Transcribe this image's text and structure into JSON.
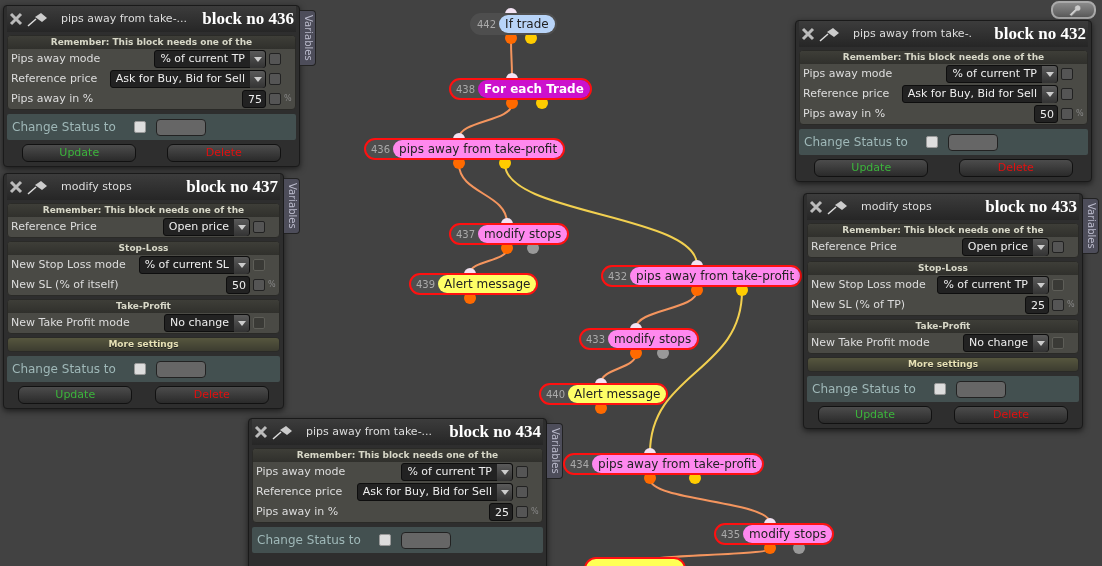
{
  "nodes": [
    {
      "number": "442",
      "label": "If trade",
      "color": "#b8d4f8",
      "outlined": false,
      "bold": false
    },
    {
      "number": "438",
      "label": "For each Trade",
      "color": "#cc11cc",
      "outlined": true,
      "bold": true
    },
    {
      "number": "436",
      "label": "pips away from take-profit",
      "color": "#ff88ee",
      "outlined": true,
      "bold": false
    },
    {
      "number": "437",
      "label": "modify stops",
      "color": "#ff88ee",
      "outlined": true,
      "bold": false
    },
    {
      "number": "439",
      "label": "Alert message",
      "color": "#ffff66",
      "outlined": true,
      "bold": false
    },
    {
      "number": "432",
      "label": "pips away from take-profit",
      "color": "#ff88ee",
      "outlined": true,
      "bold": false
    },
    {
      "number": "433",
      "label": "modify stops",
      "color": "#ff88ee",
      "outlined": true,
      "bold": false
    },
    {
      "number": "440",
      "label": "Alert message",
      "color": "#ffff66",
      "outlined": true,
      "bold": false
    },
    {
      "number": "434",
      "label": "pips away from take-profit",
      "color": "#ff88ee",
      "outlined": true,
      "bold": false
    },
    {
      "number": "435",
      "label": "modify stops",
      "color": "#ff88ee",
      "outlined": true,
      "bold": false
    }
  ],
  "panels": [
    {
      "title": "pips away from take-...",
      "block": "block no 436",
      "variables_tab": "Variables",
      "sections": [
        {
          "kind": "note",
          "header": "Remember: This block needs one of the",
          "rows": [
            {
              "kind": "select",
              "label": "Pips away mode",
              "value": "% of current TP",
              "checked": false,
              "disabled": false
            },
            {
              "kind": "select",
              "label": "Reference price",
              "value": "Ask for Buy, Bid for Sell",
              "checked": false,
              "disabled": false
            },
            {
              "kind": "number",
              "label": "Pips away in %",
              "value": "75",
              "unit": "%",
              "checked": false,
              "disabled": false
            }
          ]
        }
      ],
      "status": {
        "label": "Change Status to",
        "checked": false
      },
      "buttons": [
        {
          "label": "Update",
          "kind": "update"
        },
        {
          "label": "Delete",
          "kind": "delete"
        }
      ]
    },
    {
      "title": "pips away from take-.",
      "block": "block no 432",
      "sections": [
        {
          "kind": "note",
          "header": "Remember: This block needs one of the",
          "rows": [
            {
              "kind": "select",
              "label": "Pips away mode",
              "value": "% of current TP",
              "checked": false,
              "disabled": false
            },
            {
              "kind": "select",
              "label": "Reference price",
              "value": "Ask for Buy, Bid for Sell",
              "checked": false,
              "disabled": false
            },
            {
              "kind": "number",
              "label": "Pips away in %",
              "value": "50",
              "unit": "%",
              "checked": false,
              "disabled": false
            }
          ]
        }
      ],
      "status": {
        "label": "Change Status to",
        "checked": false
      },
      "buttons": [
        {
          "label": "Update",
          "kind": "update"
        },
        {
          "label": "Delete",
          "kind": "delete"
        }
      ]
    },
    {
      "title": "modify stops",
      "block": "block no 437",
      "variables_tab": "Variables",
      "sections": [
        {
          "kind": "note",
          "header": "Remember: This block needs one of the",
          "rows": [
            {
              "kind": "select",
              "label": "Reference Price",
              "value": "Open price",
              "checked": false,
              "disabled": false
            }
          ]
        },
        {
          "kind": "group",
          "header": "Stop-Loss",
          "rows": [
            {
              "kind": "select",
              "label": "New Stop Loss mode",
              "value": "% of current SL",
              "checked": false,
              "disabled": true
            },
            {
              "kind": "number",
              "label": "New SL (% of itself)",
              "value": "50",
              "unit": "%",
              "checked": false,
              "disabled": false
            }
          ]
        },
        {
          "kind": "group",
          "header": "Take-Profit",
          "rows": [
            {
              "kind": "select",
              "label": "New Take Profit mode",
              "value": "No change",
              "checked": false,
              "disabled": true
            }
          ]
        },
        {
          "kind": "more",
          "header": "More settings"
        }
      ],
      "status": {
        "label": "Change Status to",
        "checked": false
      },
      "buttons": [
        {
          "label": "Update",
          "kind": "update"
        },
        {
          "label": "Delete",
          "kind": "delete"
        }
      ]
    },
    {
      "title": "modify stops",
      "block": "block no 433",
      "variables_tab": "Variables",
      "sections": [
        {
          "kind": "note",
          "header": "Remember: This block needs one of the",
          "rows": [
            {
              "kind": "select",
              "label": "Reference Price",
              "value": "Open price",
              "checked": false,
              "disabled": false
            }
          ]
        },
        {
          "kind": "group",
          "header": "Stop-Loss",
          "rows": [
            {
              "kind": "select",
              "label": "New Stop Loss mode",
              "value": "% of current TP",
              "checked": false,
              "disabled": true
            },
            {
              "kind": "number",
              "label": "New SL (% of TP)",
              "value": "25",
              "unit": "%",
              "checked": false,
              "disabled": false
            }
          ]
        },
        {
          "kind": "group",
          "header": "Take-Profit",
          "rows": [
            {
              "kind": "select",
              "label": "New Take Profit mode",
              "value": "No change",
              "checked": false,
              "disabled": true
            }
          ]
        },
        {
          "kind": "more",
          "header": "More settings"
        }
      ],
      "status": {
        "label": "Change Status to",
        "checked": false
      },
      "buttons": [
        {
          "label": "Update",
          "kind": "update"
        },
        {
          "label": "Delete",
          "kind": "delete"
        }
      ]
    },
    {
      "title": "pips away from take-...",
      "block": "block no 434",
      "variables_tab": "Variables",
      "sections": [
        {
          "kind": "note",
          "header": "Remember: This block needs one of the",
          "rows": [
            {
              "kind": "select",
              "label": "Pips away mode",
              "value": "% of current TP",
              "checked": false,
              "disabled": false
            },
            {
              "kind": "select",
              "label": "Reference price",
              "value": "Ask for Buy, Bid for Sell",
              "checked": false,
              "disabled": false
            },
            {
              "kind": "number",
              "label": "Pips away in %",
              "value": "25",
              "unit": "%",
              "checked": false,
              "disabled": false
            }
          ]
        }
      ],
      "status": {
        "label": "Change Status to",
        "checked": false
      }
    }
  ]
}
